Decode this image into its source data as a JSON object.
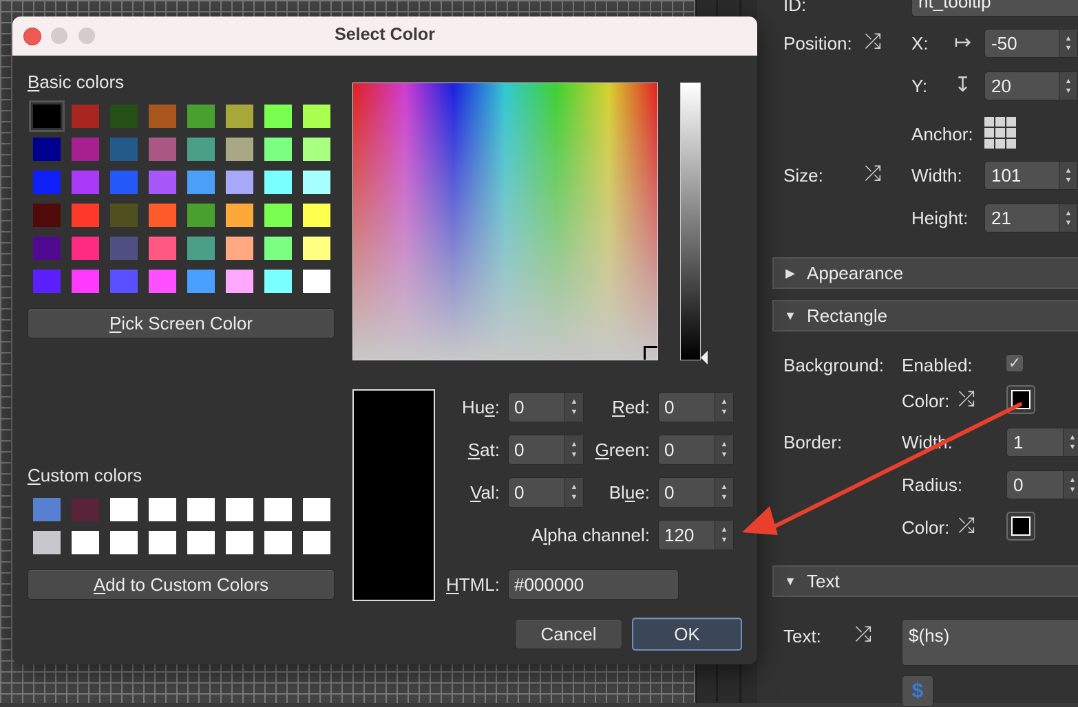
{
  "inspector": {
    "id_label": "ID:",
    "id_value": "nt_tooltip",
    "position_label": "Position:",
    "x_label": "X:",
    "x_value": "-50",
    "y_label": "Y:",
    "y_value": "20",
    "anchor_label": "Anchor:",
    "size_label": "Size:",
    "width_label": "Width:",
    "width_value": "101",
    "height_label": "Height:",
    "height_value": "21",
    "sections": {
      "appearance": "Appearance",
      "rectangle": "Rectangle",
      "text": "Text"
    },
    "background_label": "Background:",
    "enabled_label": "Enabled:",
    "bg_color_label": "Color:",
    "border_label": "Border:",
    "border_width_label": "Width:",
    "border_width_value": "1",
    "radius_label": "Radius:",
    "radius_value": "0",
    "border_color_label": "Color:",
    "text_label": "Text:",
    "text_value": "$(hs)",
    "dollar_button": "$"
  },
  "dialog": {
    "title": "Select Color",
    "basic_colors_label": "Basic colors",
    "custom_colors_label": "Custom colors",
    "pick_screen_color": "Pick Screen Color",
    "add_to_custom": "Add to Custom Colors",
    "hue_label": "Hue:",
    "hue_value": "0",
    "sat_label": "Sat:",
    "sat_value": "0",
    "val_label": "Val:",
    "val_value": "0",
    "red_label": "Red:",
    "red_value": "0",
    "green_label": "Green:",
    "green_value": "0",
    "blue_label": "Blue:",
    "blue_value": "0",
    "alpha_label": "Alpha channel:",
    "alpha_value": "120",
    "html_label": "HTML:",
    "html_value": "#000000",
    "cancel": "Cancel",
    "ok": "OK",
    "preview_color": "#000000",
    "basic_colors": [
      "#000000",
      "#a82520",
      "#245018",
      "#a8561e",
      "#4aa02e",
      "#a8a83a",
      "#7aff50",
      "#a8ff50",
      "#000090",
      "#a82090",
      "#245a8a",
      "#a85882",
      "#4aa086",
      "#a8a884",
      "#7aff82",
      "#a8ff82",
      "#1020f8",
      "#a83af8",
      "#2458f8",
      "#a858f8",
      "#4aa0f8",
      "#a8a8f8",
      "#7affff",
      "#a8ffff",
      "#500a0a",
      "#ff3a2a",
      "#50501e",
      "#ff5a2a",
      "#4aa02e",
      "#ffa83a",
      "#7aff50",
      "#ffff50",
      "#500a90",
      "#ff2a82",
      "#505082",
      "#ff5882",
      "#4aa086",
      "#ffa882",
      "#7aff82",
      "#ffff82",
      "#5a20ff",
      "#ff3aff",
      "#5a50ff",
      "#ff50ff",
      "#4aa0ff",
      "#ffa8ff",
      "#7affff",
      "#ffffff"
    ],
    "custom_colors": [
      "#5880d0",
      "#5a2438",
      "#ffffff",
      "#ffffff",
      "#ffffff",
      "#ffffff",
      "#ffffff",
      "#ffffff",
      "#c8c8cc",
      "#ffffff",
      "#ffffff",
      "#ffffff",
      "#ffffff",
      "#ffffff",
      "#ffffff",
      "#ffffff"
    ]
  }
}
